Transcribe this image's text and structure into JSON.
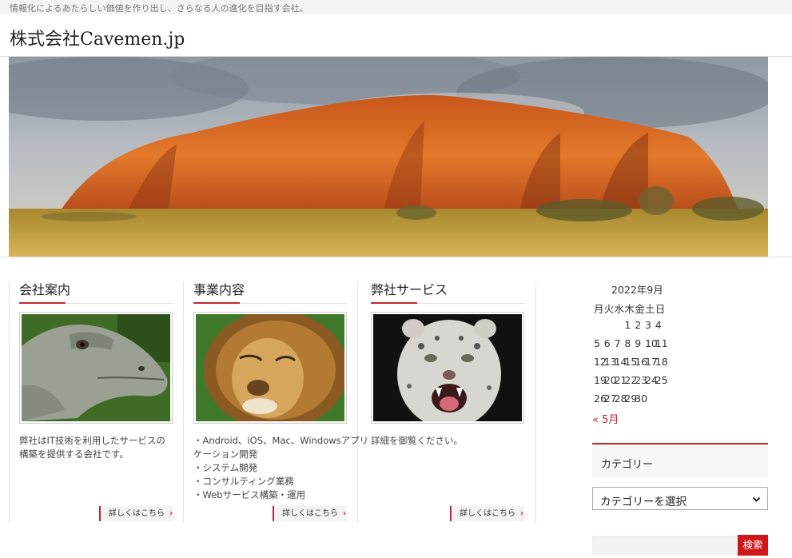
{
  "header": {
    "tagline": "情報化によるあたらしい価値を作り出し、さらなる人の進化を目指す会社。",
    "site_title": "株式会社Cavemen.jp"
  },
  "columns": [
    {
      "title": "会社案内",
      "image": "komodo-dragon",
      "text": [
        "弊社はIT技術を利用したサービスの",
        "構築を提供する会社です。"
      ],
      "more_label": "詳しくはこちら"
    },
    {
      "title": "事業内容",
      "image": "lion",
      "text": [
        "・Android、iOS、Mac、Windowsアプリ",
        "ケーション開発",
        "・システム開発",
        "・コンサルティング業務",
        "・Webサービス構築・運用"
      ],
      "more_label": "詳しくはこちら"
    },
    {
      "title": "弊社サービス",
      "image": "snow-leopard",
      "text": [
        "詳細を御覧ください。"
      ],
      "more_label": "詳しくはこちら"
    }
  ],
  "calendar": {
    "caption": "2022年9月",
    "weekdays": [
      "月",
      "火",
      "水",
      "木",
      "金",
      "土",
      "日"
    ],
    "rows": [
      [
        "",
        "",
        "",
        "1",
        "2",
        "3",
        "4"
      ],
      [
        "5",
        "6",
        "7",
        "8",
        "9",
        "10",
        "11"
      ],
      [
        "12",
        "13",
        "14",
        "15",
        "16",
        "17",
        "18"
      ],
      [
        "19",
        "20",
        "21",
        "22",
        "23",
        "24",
        "25"
      ],
      [
        "26",
        "27",
        "28",
        "29",
        "30",
        "",
        ""
      ]
    ],
    "prev_link": "« 5月"
  },
  "sidebar": {
    "category_title": "カテゴリー",
    "category_select": "カテゴリーを選択",
    "search_button": "検索"
  },
  "colors": {
    "accent": "#c0282d",
    "search_button": "#d0161b"
  },
  "icons": {
    "more_chevron": "›",
    "select_arrow": "chevron-down-icon"
  }
}
